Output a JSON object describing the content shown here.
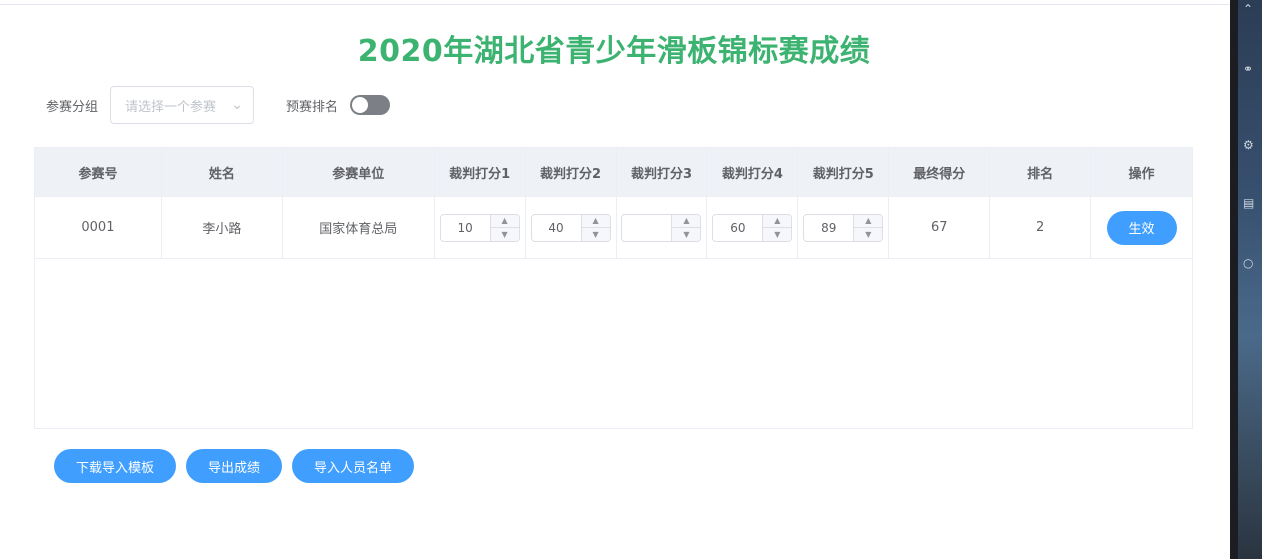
{
  "title": "2020年湖北省青少年滑板锦标赛成绩",
  "filter": {
    "group_label": "参赛分组",
    "group_placeholder": "请选择一个参赛",
    "prelim_label": "预赛排名"
  },
  "table": {
    "headers": [
      "参赛号",
      "姓名",
      "参赛单位",
      "裁判打分1",
      "裁判打分2",
      "裁判打分3",
      "裁判打分4",
      "裁判打分5",
      "最终得分",
      "排名",
      "操作"
    ],
    "rows": [
      {
        "id": "0001",
        "name": "李小路",
        "unit": "国家体育总局",
        "scores": [
          "10",
          "40",
          "",
          "60",
          "89"
        ],
        "final": "67",
        "rank": "2",
        "action": "生效"
      }
    ]
  },
  "actions": {
    "download_template": "下载导入模板",
    "export_scores": "导出成绩",
    "import_roster": "导入人员名单"
  },
  "colors": {
    "title": "#3cb371",
    "primary": "#409eff",
    "header_bg": "#eef1f6"
  }
}
